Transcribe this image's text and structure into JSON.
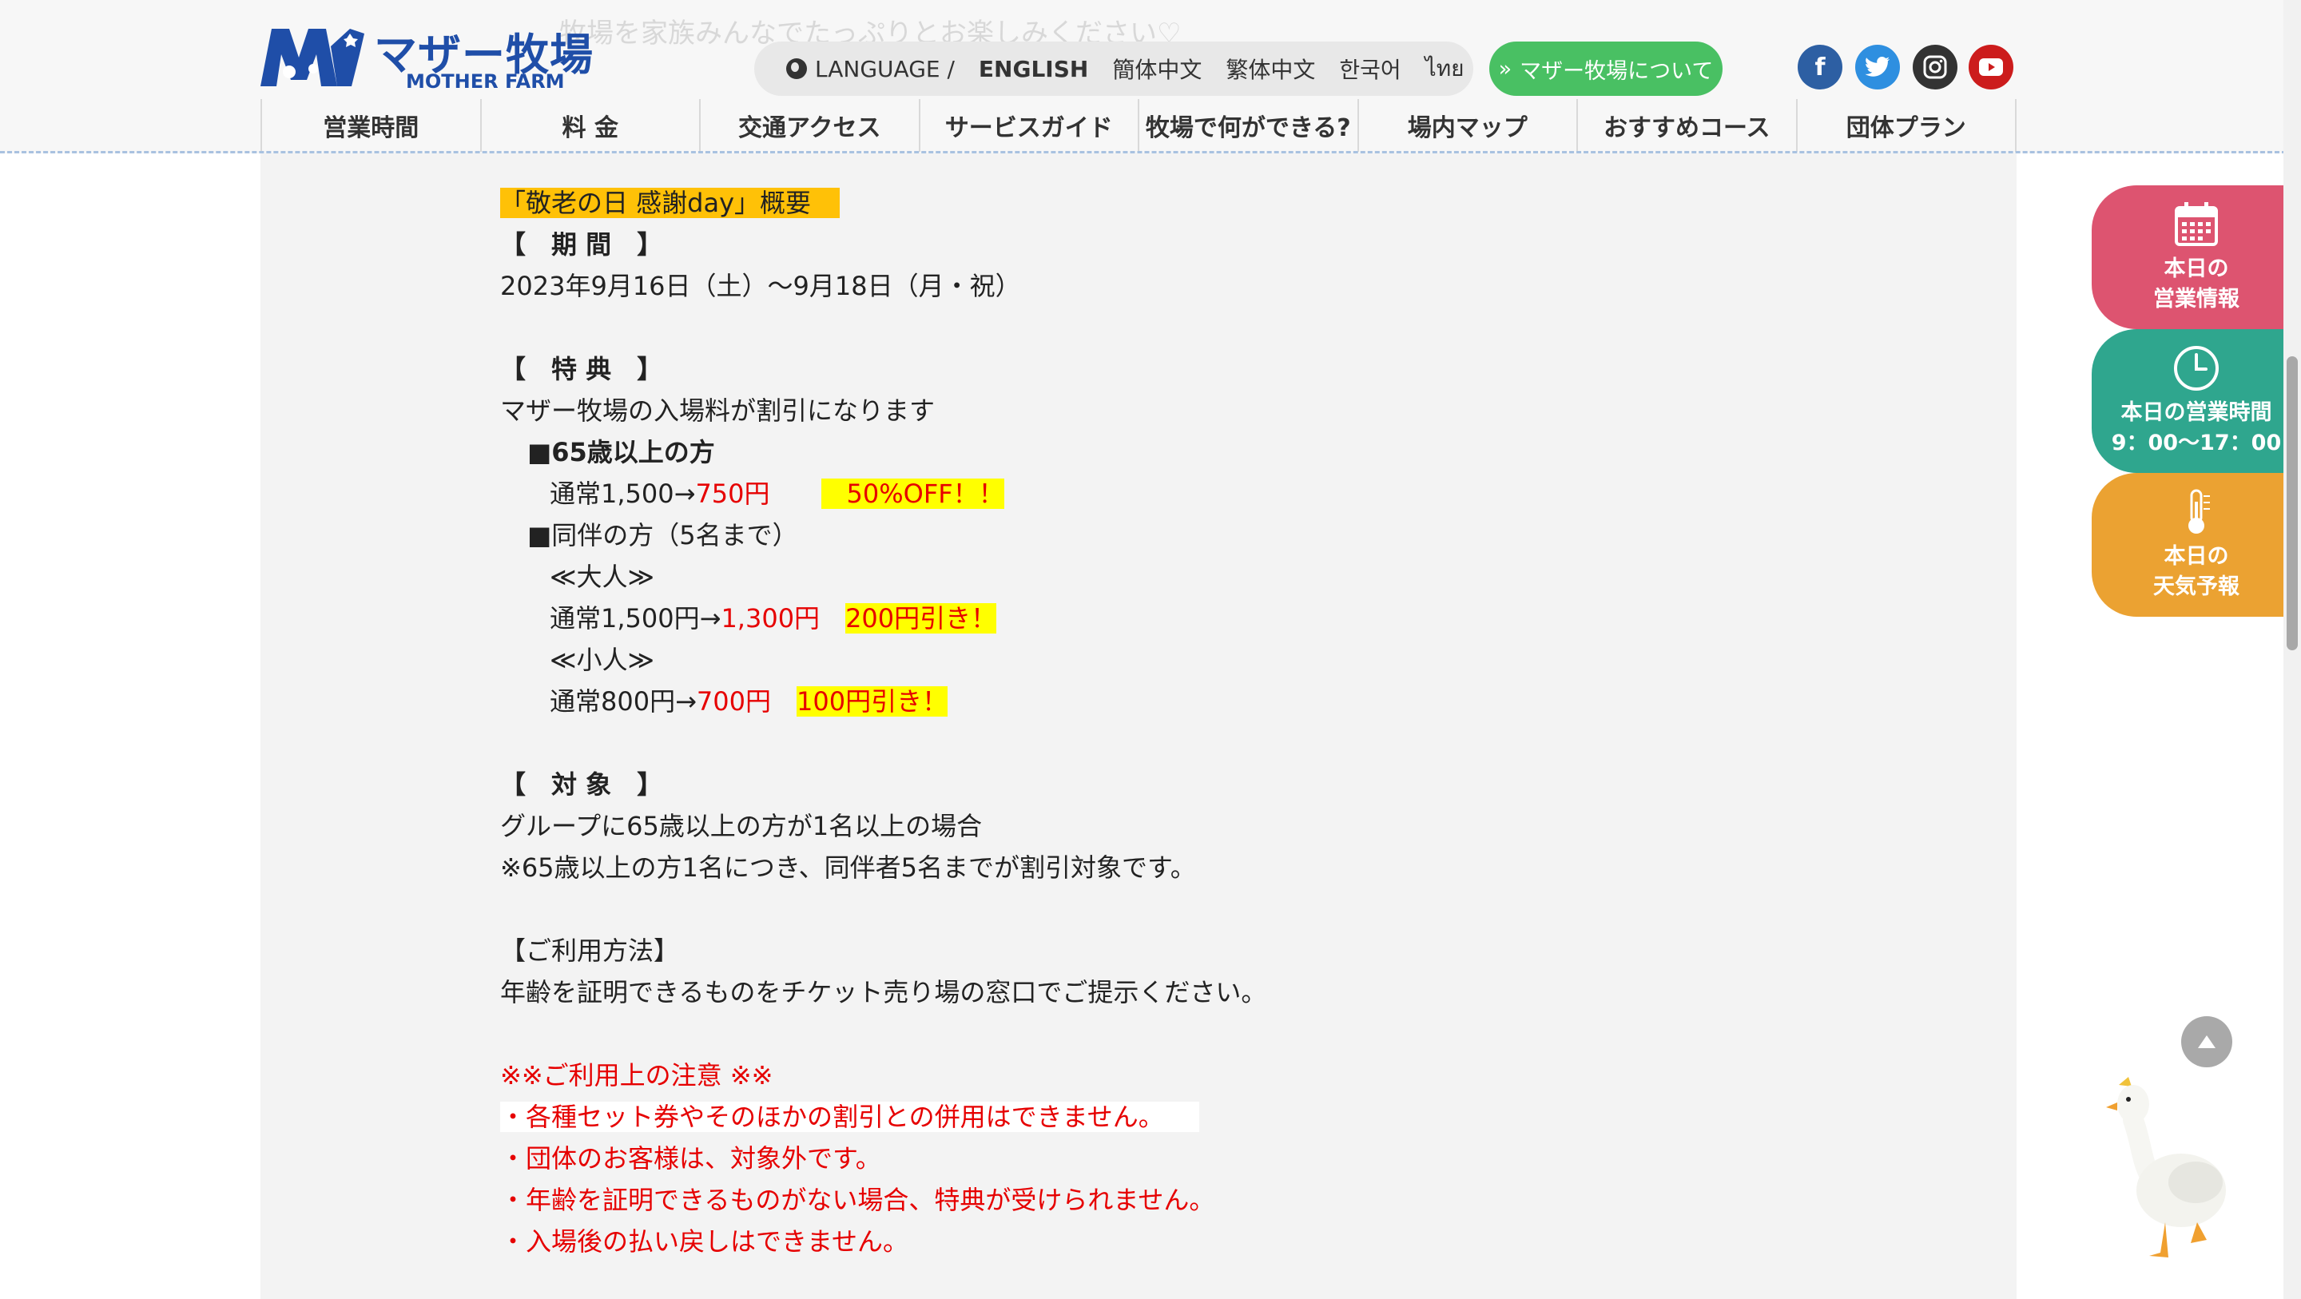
{
  "header": {
    "tagline": "牧場を家族みんなでたっぷりとお楽しみください♡",
    "logo_title": "マザー牧場",
    "logo_sub": "MOTHER FARM",
    "language_label": "LANGUAGE /",
    "languages": [
      "ENGLISH",
      "簡体中文",
      "繁体中文",
      "한국어",
      "ไทย"
    ],
    "about_button": "マザー牧場について",
    "social": [
      {
        "name": "facebook",
        "glyph": "f"
      },
      {
        "name": "twitter",
        "glyph": "t"
      },
      {
        "name": "instagram",
        "glyph": "◎"
      },
      {
        "name": "youtube",
        "glyph": "▶"
      }
    ]
  },
  "nav": [
    "営業時間",
    "料 金",
    "交通アクセス",
    "サービスガイド",
    "牧場で何ができる?",
    "場内マップ",
    "おすすめコース",
    "団体プラン"
  ],
  "article": {
    "title": "「敬老の日 感謝day」概要",
    "period_heading": "【　期 間　】",
    "period": "2023年9月16日（土）～9月18日（月・祝）",
    "benefit_heading": "【　特 典　】",
    "benefit_intro": "マザー牧場の入場料が割引になります",
    "senior_label": "■65歳以上の方",
    "senior_normal": "通常1,500→",
    "senior_price": "750円",
    "senior_off": "　50%OFF！！",
    "companion_label": "■同伴の方（5名まで）",
    "adult_label": "≪大人≫",
    "adult_normal": "通常1,500円→",
    "adult_price": "1,300円",
    "adult_off": "200円引き！",
    "child_label": "≪小人≫",
    "child_normal": "通常800円→",
    "child_price": "700円",
    "child_off": "100円引き！",
    "target_heading": "【　対 象　】",
    "target_1": "グループに65歳以上の方が1名以上の場合",
    "target_2": "※65歳以上の方1名につき、同伴者5名までが割引対象です。",
    "usage_heading": "【ご利用方法】",
    "usage": "年齢を証明できるものをチケット売り場の窓口でご提示ください。",
    "notice_heading": "※※ご利用上の注意 ※※",
    "notices": [
      "・各種セット券やそのほかの割引との併用はできません。",
      "・団体のお客様は、対象外です。",
      "・年齢を証明できるものがない場合、特典が受けられません。",
      "・入場後の払い戻しはできません。"
    ]
  },
  "side_tabs": {
    "info": [
      "本日の",
      "営業情報"
    ],
    "hours": [
      "本日の営業時間",
      "9：00～17：00"
    ],
    "weather": [
      "本日の",
      "天気予報"
    ]
  },
  "colors": {
    "brand_blue": "#1f4ea8",
    "about_green": "#49c063",
    "tab_pink": "#dd5470",
    "tab_teal": "#2fa68e",
    "tab_orange": "#eba232",
    "price_red": "#e60000",
    "highlight_yellow": "#ffff00",
    "title_orange": "#ffc107"
  }
}
